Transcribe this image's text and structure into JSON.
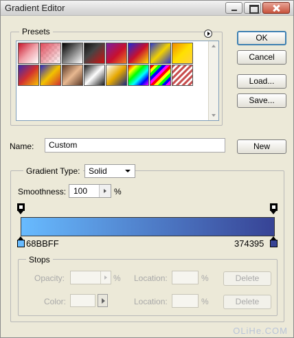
{
  "window": {
    "title": "Gradient Editor",
    "controls": [
      "minimize-icon",
      "maximize-icon",
      "close-icon"
    ]
  },
  "presets": {
    "label": "Presets",
    "menu_icon": "flyout-menu-icon",
    "swatches": [
      {
        "css": "linear-gradient(135deg,#c8152b 0%,#f0a0a8 50%,#ffffff 100%)"
      },
      {
        "css": "linear-gradient(135deg,#e04a5a 0%,rgba(255,255,255,0) 100%), repeating-conic-gradient(#ffffff 0 25%, #e6e6e6 0 50%) 0 0/8px 8px"
      },
      {
        "css": "linear-gradient(135deg,#000000 0%,#ffffff 100%)"
      },
      {
        "css": "linear-gradient(135deg,#111111 0%,#444444 40%,#d01010 100%)"
      },
      {
        "css": "linear-gradient(135deg,#7a1fa2 0%,#c8102e 55%,#f08020 100%)"
      },
      {
        "css": "linear-gradient(135deg,#1f2ad8 0%,#c8102e 50%,#ffe000 100%)"
      },
      {
        "css": "linear-gradient(135deg,#2a37d0 0%,#f2d200 50%,#2a37d0 100%)"
      },
      {
        "css": "linear-gradient(135deg,#f08a00 0%,#ffe000 50%,#ffd040 100%)"
      },
      {
        "css": "linear-gradient(135deg,#3a2bb0 0%,#d23030 50%,#f6c000 100%)"
      },
      {
        "css": "linear-gradient(135deg,#2828c8 0%,#f2c200 50%,#d03030 100%)"
      },
      {
        "css": "linear-gradient(135deg,#5c3a28 0%,#e8b890 50%,#5c3a28 100%)"
      },
      {
        "css": "linear-gradient(135deg,#1a1a1a 0%,#ffffff 50%,#1a1a1a 100%)"
      },
      {
        "css": "linear-gradient(135deg,#ffffff 0%,#e6a800 50%,#1a2a80 100%)"
      },
      {
        "css": "linear-gradient(135deg,#ff0000,#ffff00,#00ff00,#00ffff,#0000ff,#ff00ff)"
      },
      {
        "css": "repeating-linear-gradient(135deg,#ff0000 0 4px,#ffff00 4px 8px,#00ff00 8px 12px,#0000ff 12px 16px,#ff00ff 16px 20px)"
      },
      {
        "css": "repeating-linear-gradient(135deg,#c85050 0 3px,#ffffff 3px 6px)"
      }
    ]
  },
  "buttons": {
    "ok": "OK",
    "cancel": "Cancel",
    "load": "Load...",
    "save": "Save...",
    "new": "New"
  },
  "name": {
    "label": "Name:",
    "value": "Custom"
  },
  "gradient": {
    "type_label": "Gradient Type:",
    "type_value": "Solid",
    "smoothness_label": "Smoothness:",
    "smoothness_value": "100",
    "smoothness_unit": "%",
    "colors": {
      "left": "#68BBFF",
      "right": "#374395"
    },
    "left_hex": "68BBFF",
    "right_hex": "374395"
  },
  "stops": {
    "label": "Stops",
    "opacity_label": "Opacity:",
    "opacity_unit": "%",
    "location_label": "Location:",
    "location_unit": "%",
    "color_label": "Color:",
    "delete_label": "Delete"
  },
  "watermark": "OLiHe.COM"
}
